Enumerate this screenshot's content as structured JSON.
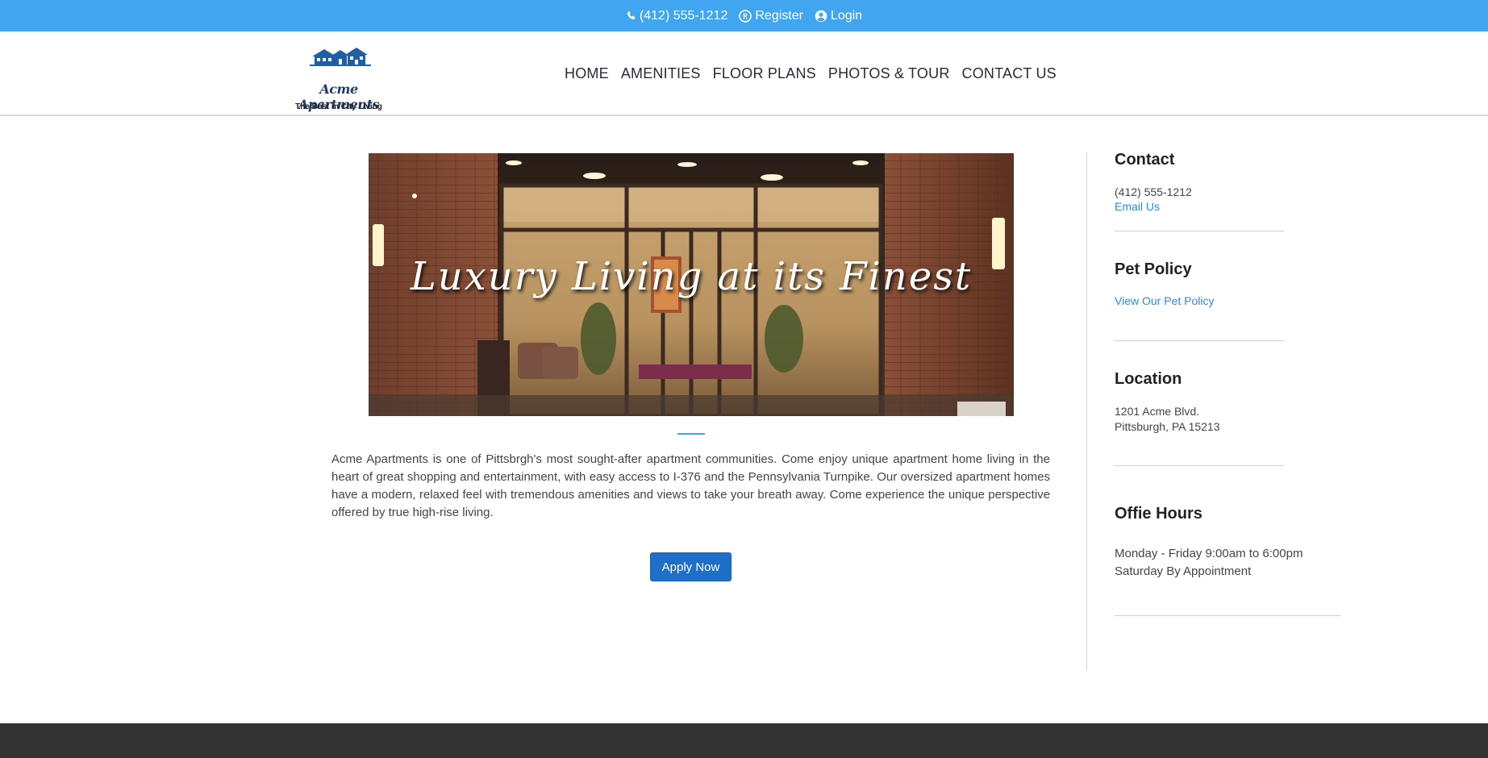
{
  "topbar": {
    "phone": "(412) 555-1212",
    "register": "Register",
    "login": "Login"
  },
  "logo": {
    "title": "Acme Apartments",
    "tagline": "The Best in City Living"
  },
  "nav": {
    "items": [
      "HOME",
      "AMENITIES",
      "FLOOR PLANS",
      "PHOTOS & TOUR",
      "CONTACT US"
    ]
  },
  "hero": {
    "title": "Luxury Living at its Finest"
  },
  "intro": {
    "text": "Acme Apartments is one of Pittsbrgh's most sought-after apartment communities. Come enjoy unique apartment home living in the heart of great shopping and entertainment, with easy access to I-376 and the Pennsylvania Turnpike. Our oversized apartment homes have a modern, relaxed feel with tremendous amenities and views to take your breath away. Come experience the unique perspective offered by true high-rise living."
  },
  "apply_button": "Apply Now",
  "sidebar": {
    "contact": {
      "heading": "Contact",
      "phone": "(412) 555-1212",
      "email_link": "Email Us"
    },
    "pet_policy": {
      "heading": "Pet Policy",
      "link": "View Our Pet Policy"
    },
    "location": {
      "heading": "Location",
      "line1": "1201 Acme Blvd.",
      "line2": "Pittsburgh, PA 15213"
    },
    "hours": {
      "heading": "Offie Hours",
      "line1": "Monday - Friday 9:00am to 6:00pm",
      "line2": "Saturday By Appointment"
    }
  },
  "colors": {
    "topbar": "#42a5f0",
    "accent": "#42a5f0",
    "button": "#1e6fc7",
    "link": "#2a8be0",
    "footer": "#333333"
  },
  "icons": {
    "phone": "phone-icon",
    "register": "registered-icon",
    "login": "user-circle-icon"
  }
}
